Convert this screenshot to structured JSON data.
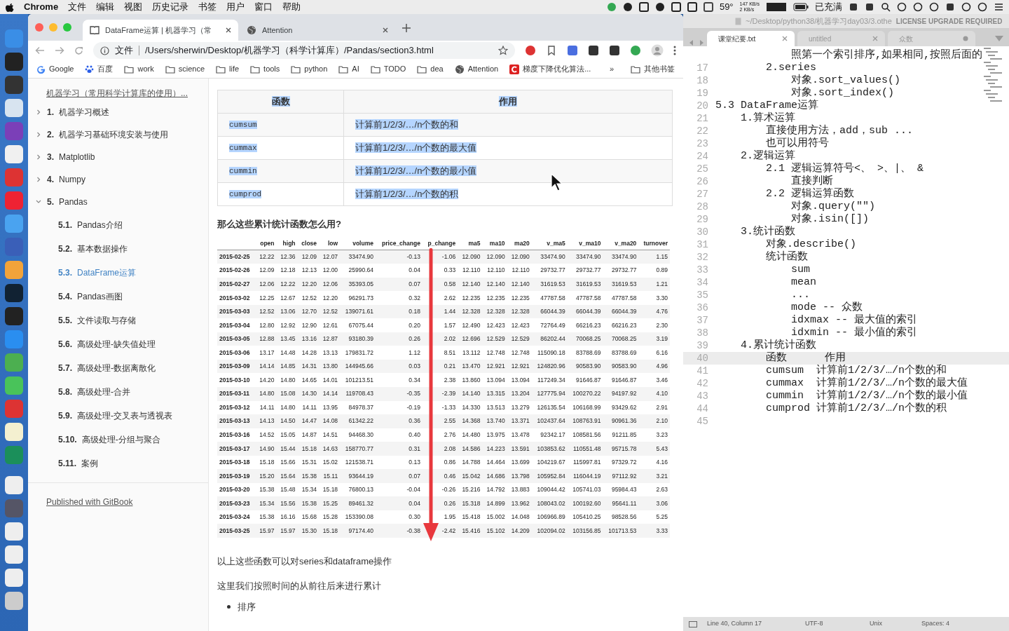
{
  "menubar": {
    "app": "Chrome",
    "menus": [
      "文件",
      "编辑",
      "视图",
      "历史记录",
      "书签",
      "用户",
      "窗口",
      "帮助"
    ],
    "temperature": "59°",
    "net_up": "147 KB/s",
    "net_down": "2 KB/s",
    "battery": "已充满"
  },
  "browser": {
    "tabs": [
      {
        "title": "DataFrame运算 | 机器学习（常",
        "selected": true,
        "kind": "book"
      },
      {
        "title": "Attention",
        "selected": false,
        "kind": "globe"
      }
    ],
    "address": {
      "scheme": "文件",
      "url": "/Users/sherwin/Desktop/机器学习（科学计算库）/Pandas/section3.html"
    },
    "bookmarks": [
      {
        "label": "Google",
        "kind": "google"
      },
      {
        "label": "百度",
        "kind": "paw"
      },
      {
        "label": "work",
        "kind": "folder"
      },
      {
        "label": "science",
        "kind": "folder"
      },
      {
        "label": "life",
        "kind": "folder"
      },
      {
        "label": "tools",
        "kind": "folder"
      },
      {
        "label": "python",
        "kind": "folder"
      },
      {
        "label": "AI",
        "kind": "folder"
      },
      {
        "label": "TODO",
        "kind": "folder"
      },
      {
        "label": "dea",
        "kind": "folder"
      },
      {
        "label": "Attention",
        "kind": "globe"
      },
      {
        "label": "梯度下降优化算法...",
        "kind": "csdn"
      }
    ],
    "more": "»",
    "other_bookmarks": "其他书签"
  },
  "sidebar": {
    "book_title": "机器学习（常用科学计算库的使用）...",
    "items": [
      {
        "number": "1.",
        "title": "机器学习概述",
        "expanded": false,
        "selected": false
      },
      {
        "number": "2.",
        "title": "机器学习基础环境安装与使用",
        "expanded": false,
        "selected": false
      },
      {
        "number": "3.",
        "title": "Matplotlib",
        "expanded": false,
        "selected": false
      },
      {
        "number": "4.",
        "title": "Numpy",
        "expanded": false,
        "selected": false
      },
      {
        "number": "5.",
        "title": "Pandas",
        "expanded": true,
        "selected": false,
        "children": [
          {
            "number": "5.1.",
            "title": "Pandas介绍",
            "selected": false
          },
          {
            "number": "5.2.",
            "title": "基本数据操作",
            "selected": false
          },
          {
            "number": "5.3.",
            "title": "DataFrame运算",
            "selected": true
          },
          {
            "number": "5.4.",
            "title": "Pandas画图",
            "selected": false
          },
          {
            "number": "5.5.",
            "title": "文件读取与存储",
            "selected": false
          },
          {
            "number": "5.6.",
            "title": "高级处理-缺失值处理",
            "selected": false
          },
          {
            "number": "5.7.",
            "title": "高级处理-数据离散化",
            "selected": false
          },
          {
            "number": "5.8.",
            "title": "高级处理-合并",
            "selected": false
          },
          {
            "number": "5.9.",
            "title": "高级处理-交叉表与透视表",
            "selected": false
          },
          {
            "number": "5.10.",
            "title": "高级处理-分组与聚合",
            "selected": false
          },
          {
            "number": "5.11.",
            "title": "案例",
            "selected": false
          }
        ]
      }
    ],
    "footer": "Published with GitBook"
  },
  "page": {
    "function_table": {
      "highlighted": true,
      "columns": [
        "函数",
        "作用"
      ],
      "rows": [
        [
          "cumsum",
          "计算前1/2/3/…/n个数的和"
        ],
        [
          "cummax",
          "计算前1/2/3/…/n个数的最大值"
        ],
        [
          "cummin",
          "计算前1/2/3/…/n个数的最小值"
        ],
        [
          "cumprod",
          "计算前1/2/3/…/n个数的积"
        ]
      ]
    },
    "question": "那么这些累计统计函数怎么用?",
    "dataframe": {
      "columns": [
        "open",
        "high",
        "close",
        "low",
        "volume",
        "price_change",
        "p_change",
        "ma5",
        "ma10",
        "ma20",
        "v_ma5",
        "v_ma10",
        "v_ma20",
        "turnover"
      ],
      "rows": [
        {
          "index": "2015-02-25",
          "cells": [
            "12.22",
            "12.36",
            "12.09",
            "12.07",
            "33474.90",
            "-0.13",
            "-1.06",
            "12.090",
            "12.090",
            "12.090",
            "33474.90",
            "33474.90",
            "33474.90",
            "1.15"
          ]
        },
        {
          "index": "2015-02-26",
          "cells": [
            "12.09",
            "12.18",
            "12.13",
            "12.00",
            "25990.64",
            "0.04",
            "0.33",
            "12.110",
            "12.110",
            "12.110",
            "29732.77",
            "29732.77",
            "29732.77",
            "0.89"
          ]
        },
        {
          "index": "2015-02-27",
          "cells": [
            "12.06",
            "12.22",
            "12.20",
            "12.06",
            "35393.05",
            "0.07",
            "0.58",
            "12.140",
            "12.140",
            "12.140",
            "31619.53",
            "31619.53",
            "31619.53",
            "1.21"
          ]
        },
        {
          "index": "2015-03-02",
          "cells": [
            "12.25",
            "12.67",
            "12.52",
            "12.20",
            "96291.73",
            "0.32",
            "2.62",
            "12.235",
            "12.235",
            "12.235",
            "47787.58",
            "47787.58",
            "47787.58",
            "3.30"
          ]
        },
        {
          "index": "2015-03-03",
          "cells": [
            "12.52",
            "13.06",
            "12.70",
            "12.52",
            "139071.61",
            "0.18",
            "1.44",
            "12.328",
            "12.328",
            "12.328",
            "66044.39",
            "66044.39",
            "66044.39",
            "4.76"
          ]
        },
        {
          "index": "2015-03-04",
          "cells": [
            "12.80",
            "12.92",
            "12.90",
            "12.61",
            "67075.44",
            "0.20",
            "1.57",
            "12.490",
            "12.423",
            "12.423",
            "72764.49",
            "66216.23",
            "66216.23",
            "2.30"
          ]
        },
        {
          "index": "2015-03-05",
          "cells": [
            "12.88",
            "13.45",
            "13.16",
            "12.87",
            "93180.39",
            "0.26",
            "2.02",
            "12.696",
            "12.529",
            "12.529",
            "86202.44",
            "70068.25",
            "70068.25",
            "3.19"
          ]
        },
        {
          "index": "2015-03-06",
          "cells": [
            "13.17",
            "14.48",
            "14.28",
            "13.13",
            "179831.72",
            "1.12",
            "8.51",
            "13.112",
            "12.748",
            "12.748",
            "115090.18",
            "83788.69",
            "83788.69",
            "6.16"
          ]
        },
        {
          "index": "2015-03-09",
          "cells": [
            "14.14",
            "14.85",
            "14.31",
            "13.80",
            "144945.66",
            "0.03",
            "0.21",
            "13.470",
            "12.921",
            "12.921",
            "124820.96",
            "90583.90",
            "90583.90",
            "4.96"
          ]
        },
        {
          "index": "2015-03-10",
          "cells": [
            "14.20",
            "14.80",
            "14.65",
            "14.01",
            "101213.51",
            "0.34",
            "2.38",
            "13.860",
            "13.094",
            "13.094",
            "117249.34",
            "91646.87",
            "91646.87",
            "3.46"
          ]
        },
        {
          "index": "2015-03-11",
          "cells": [
            "14.80",
            "15.08",
            "14.30",
            "14.14",
            "119708.43",
            "-0.35",
            "-2.39",
            "14.140",
            "13.315",
            "13.204",
            "127775.94",
            "100270.22",
            "94197.92",
            "4.10"
          ]
        },
        {
          "index": "2015-03-12",
          "cells": [
            "14.11",
            "14.80",
            "14.11",
            "13.95",
            "84978.37",
            "-0.19",
            "-1.33",
            "14.330",
            "13.513",
            "13.279",
            "126135.54",
            "106168.99",
            "93429.62",
            "2.91"
          ]
        },
        {
          "index": "2015-03-13",
          "cells": [
            "14.13",
            "14.50",
            "14.47",
            "14.08",
            "61342.22",
            "0.36",
            "2.55",
            "14.368",
            "13.740",
            "13.371",
            "102437.64",
            "108763.91",
            "90961.36",
            "2.10"
          ]
        },
        {
          "index": "2015-03-16",
          "cells": [
            "14.52",
            "15.05",
            "14.87",
            "14.51",
            "94468.30",
            "0.40",
            "2.76",
            "14.480",
            "13.975",
            "13.478",
            "92342.17",
            "108581.56",
            "91211.85",
            "3.23"
          ]
        },
        {
          "index": "2015-03-17",
          "cells": [
            "14.90",
            "15.44",
            "15.18",
            "14.63",
            "158770.77",
            "0.31",
            "2.08",
            "14.586",
            "14.223",
            "13.591",
            "103853.62",
            "110551.48",
            "95715.78",
            "5.43"
          ]
        },
        {
          "index": "2015-03-18",
          "cells": [
            "15.18",
            "15.66",
            "15.31",
            "15.02",
            "121538.71",
            "0.13",
            "0.86",
            "14.788",
            "14.464",
            "13.699",
            "104219.67",
            "115997.81",
            "97329.72",
            "4.16"
          ]
        },
        {
          "index": "2015-03-19",
          "cells": [
            "15.20",
            "15.64",
            "15.38",
            "15.11",
            "93644.19",
            "0.07",
            "0.46",
            "15.042",
            "14.686",
            "13.798",
            "105952.84",
            "116044.19",
            "97112.92",
            "3.21"
          ]
        },
        {
          "index": "2015-03-20",
          "cells": [
            "15.38",
            "15.48",
            "15.34",
            "15.18",
            "76800.13",
            "-0.04",
            "-0.26",
            "15.216",
            "14.792",
            "13.883",
            "109044.42",
            "105741.03",
            "95984.43",
            "2.63"
          ]
        },
        {
          "index": "2015-03-23",
          "cells": [
            "15.34",
            "15.56",
            "15.38",
            "15.25",
            "89461.32",
            "0.04",
            "0.26",
            "15.318",
            "14.899",
            "13.962",
            "108043.02",
            "100192.60",
            "95641.11",
            "3.06"
          ]
        },
        {
          "index": "2015-03-24",
          "cells": [
            "15.38",
            "16.16",
            "15.68",
            "15.28",
            "153390.08",
            "0.30",
            "1.95",
            "15.418",
            "15.002",
            "14.048",
            "106966.89",
            "105410.25",
            "98528.56",
            "5.25"
          ]
        },
        {
          "index": "2015-03-25",
          "cells": [
            "15.97",
            "15.97",
            "15.30",
            "15.18",
            "97174.40",
            "-0.38",
            "-2.42",
            "15.416",
            "15.102",
            "14.209",
            "102094.02",
            "103156.85",
            "101713.53",
            "3.33"
          ]
        }
      ]
    },
    "paragraphs": [
      "以上这些函数可以对series和dataframe操作",
      "这里我们按照时间的从前往后来进行累计"
    ],
    "bullets": [
      "排序"
    ]
  },
  "editor": {
    "path": "~/Desktop/python38/机器学习day03/3.othe",
    "license": "LICENSE UPGRADE REQUIRED",
    "tabs": [
      {
        "title": "课堂纪要.txt",
        "selected": true,
        "dirty": false
      },
      {
        "title": "untitled",
        "selected": false,
        "dirty": false
      },
      {
        "title": "众数",
        "selected": false,
        "dirty": true
      }
    ],
    "lines": [
      {
        "text": "            照第一个索引排序,如果相同,按照后面的",
        "current": false
      },
      {
        "number": "17",
        "text": "        2.series",
        "current": false
      },
      {
        "number": "18",
        "text": "            对象.sort_values()",
        "current": false
      },
      {
        "number": "19",
        "text": "            对象.sort_index()",
        "current": false
      },
      {
        "number": "20",
        "text": "5.3 DataFrame运算",
        "current": false
      },
      {
        "number": "21",
        "text": "    1.算术运算",
        "current": false
      },
      {
        "number": "22",
        "text": "        直接使用方法，add，sub ...",
        "current": false
      },
      {
        "number": "23",
        "text": "        也可以用符号",
        "current": false
      },
      {
        "number": "24",
        "text": "    2.逻辑运算",
        "current": false
      },
      {
        "number": "25",
        "text": "        2.1 逻辑运算符号<、 >、|、 &",
        "current": false
      },
      {
        "number": "26",
        "text": "            直接判断",
        "current": false
      },
      {
        "number": "27",
        "text": "        2.2 逻辑运算函数",
        "current": false
      },
      {
        "number": "28",
        "text": "            对象.query(\"\")",
        "current": false
      },
      {
        "number": "29",
        "text": "            对象.isin([])",
        "current": false
      },
      {
        "number": "30",
        "text": "    3.统计函数",
        "current": false
      },
      {
        "number": "31",
        "text": "        对象.describe()",
        "current": false
      },
      {
        "number": "32",
        "text": "        统计函数",
        "current": false
      },
      {
        "number": "33",
        "text": "            sum",
        "current": false
      },
      {
        "number": "34",
        "text": "            mean",
        "current": false
      },
      {
        "number": "35",
        "text": "            ...",
        "current": false
      },
      {
        "number": "36",
        "text": "            mode -- 众数",
        "current": false
      },
      {
        "number": "37",
        "text": "            idxmax -- 最大值的索引",
        "current": false
      },
      {
        "number": "38",
        "text": "            idxmin -- 最小值的索引",
        "current": false
      },
      {
        "number": "39",
        "text": "    4.累计统计函数",
        "current": false
      },
      {
        "number": "40",
        "text": "        函数      作用",
        "current": true
      },
      {
        "number": "41",
        "text": "        cumsum  计算前1/2/3/…/n个数的和",
        "current": false
      },
      {
        "number": "42",
        "text": "        cummax  计算前1/2/3/…/n个数的最大值",
        "current": false
      },
      {
        "number": "43",
        "text": "        cummin  计算前1/2/3/…/n个数的最小值",
        "current": false
      },
      {
        "number": "44",
        "text": "        cumprod 计算前1/2/3/…/n个数的积",
        "current": false
      },
      {
        "number": "45",
        "current": false
      }
    ],
    "status": {
      "position": "Line 40, Column 17",
      "encoding": "UTF-8",
      "line_endings": "Unix",
      "indent": "Spaces: 4"
    }
  }
}
